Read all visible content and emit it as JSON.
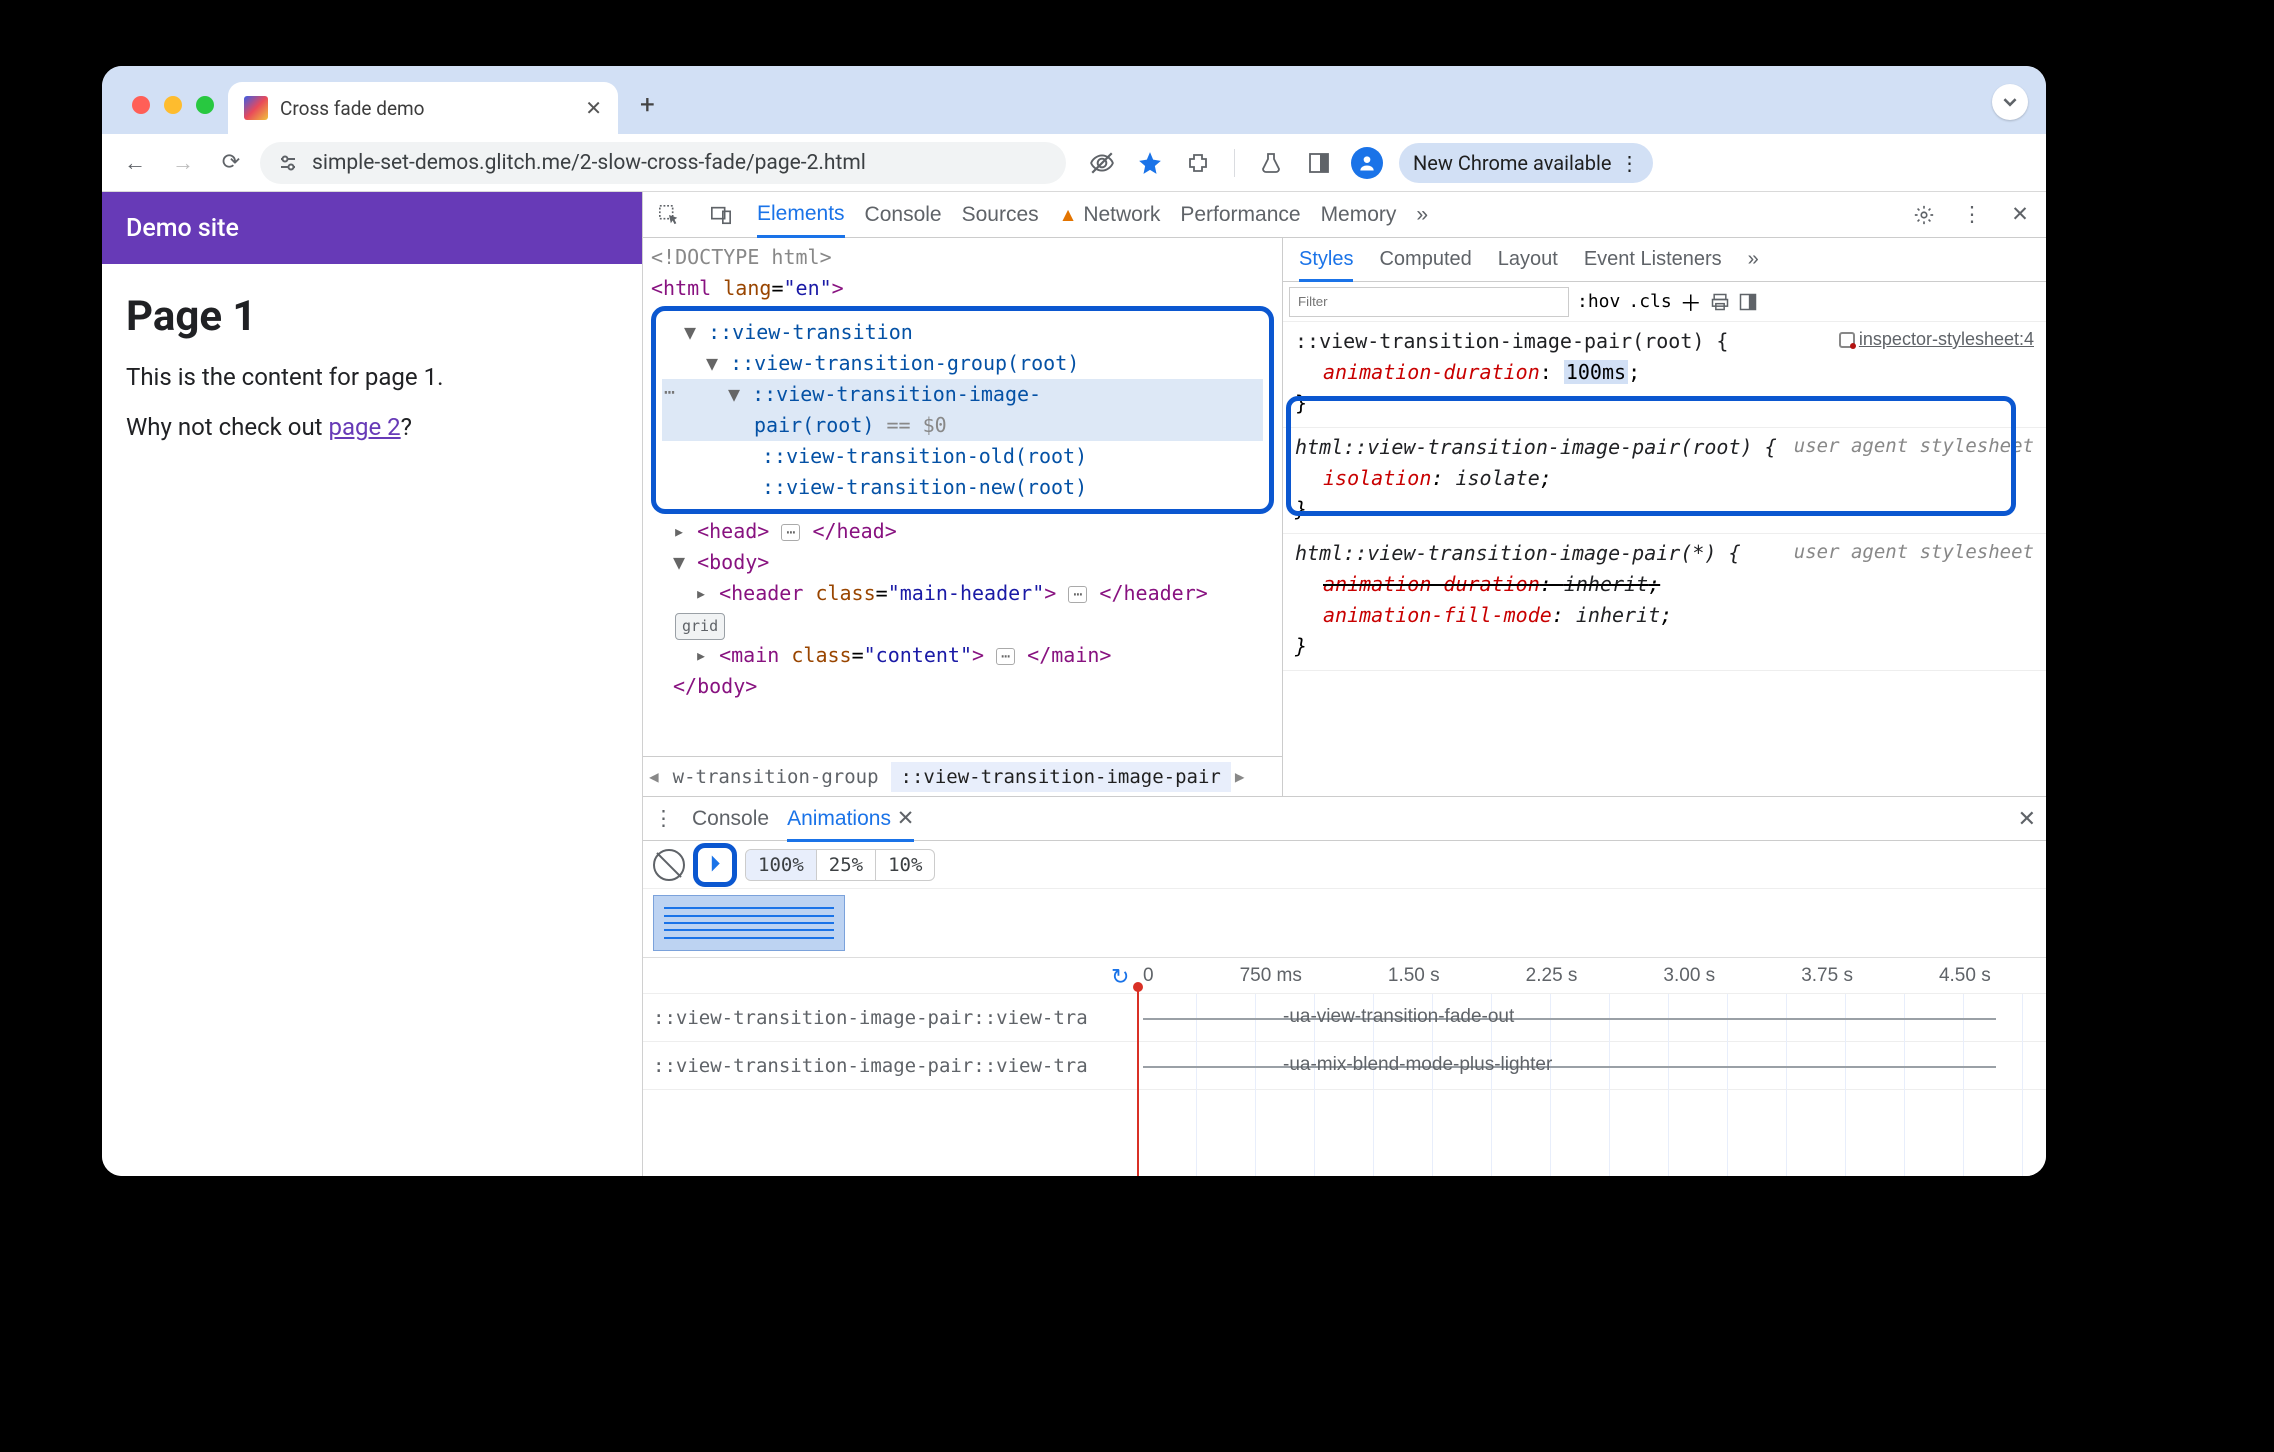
{
  "window": {
    "tab_title": "Cross fade demo",
    "url": "simple-set-demos.glitch.me/2-slow-cross-fade/page-2.html",
    "update_label": "New Chrome available"
  },
  "page": {
    "site_title": "Demo site",
    "heading": "Page 1",
    "para1": "This is the content for page 1.",
    "para2_pre": "Why not check out ",
    "para2_link": "page 2",
    "para2_post": "?"
  },
  "devtools_tabs": {
    "elements": "Elements",
    "console": "Console",
    "sources": "Sources",
    "network": "Network",
    "performance": "Performance",
    "memory": "Memory",
    "more": "»"
  },
  "dom": {
    "doctype": "<!DOCTYPE html>",
    "html_open": "<html lang=\"en\">",
    "vt": "::view-transition",
    "vtg": "::view-transition-group(root)",
    "vtip_l1": "::view-transition-image-",
    "vtip_l2": "pair(root)",
    "eq0": " == $0",
    "vtold": "::view-transition-old(root)",
    "vtnew": "::view-transition-new(root)",
    "head": "<head>… </head>",
    "body_open": "<body>",
    "header": "<header class=\"main-header\">… </header>",
    "grid_badge": "grid",
    "main": "<main class=\"content\">… </main>",
    "body_close": "</body>",
    "crumb1": "w-transition-group",
    "crumb2": "::view-transition-image-pair"
  },
  "styles_tabs": {
    "styles": "Styles",
    "computed": "Computed",
    "layout": "Layout",
    "listeners": "Event Listeners",
    "more": "»"
  },
  "styles_toolbar": {
    "filter": "Filter",
    "hov": ":hov",
    "cls": ".cls"
  },
  "rule1": {
    "selector": "::view-transition-image-pair(root) {",
    "link": "inspector-stylesheet:4",
    "prop": "animation-duration",
    "val": "100ms",
    "close": "}"
  },
  "rule2": {
    "selector": "html::view-transition-image-pair(root) {",
    "src": "user agent stylesheet",
    "prop": "isolation",
    "val": "isolate",
    "close": "}"
  },
  "rule3": {
    "selector": "html::view-transition-image-pair(*) {",
    "src": "user agent stylesheet",
    "prop1": "animation-duration",
    "val1": "inherit",
    "prop2": "animation-fill-mode",
    "val2": "inherit",
    "close": "}"
  },
  "drawer": {
    "console": "Console",
    "animations": "Animations",
    "speed100": "100%",
    "speed25": "25%",
    "speed10": "10%",
    "ruler": [
      "0",
      "750 ms",
      "1.50 s",
      "2.25 s",
      "3.00 s",
      "3.75 s",
      "4.50 s"
    ],
    "track1_label": "::view-transition-image-pair::view-tra",
    "track1_name": "-ua-view-transition-fade-out",
    "track2_label": "::view-transition-image-pair::view-tra",
    "track2_name": "-ua-mix-blend-mode-plus-lighter"
  }
}
